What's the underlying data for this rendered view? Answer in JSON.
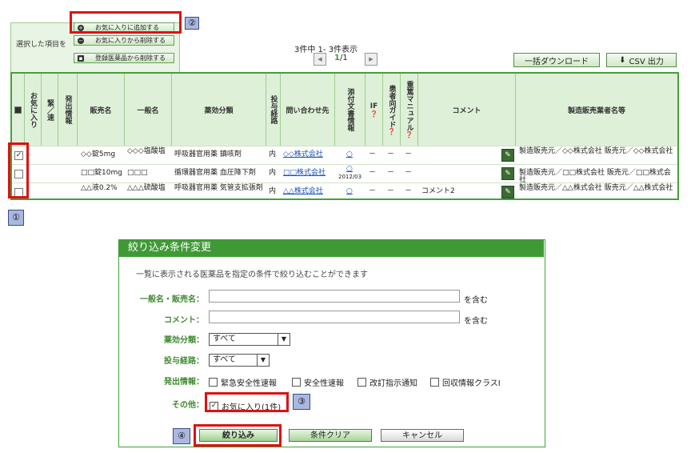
{
  "popup": {
    "label": "選択した項目を",
    "add_fav": "お気に入りに追加する",
    "remove_fav": "お気に入りから削除する",
    "remove_registered": "登録医薬品から削除する"
  },
  "annotations": {
    "n1": "①",
    "n2": "②",
    "n3": "③",
    "n4": "④"
  },
  "pagination": {
    "count": "3件中 1- 3件表示",
    "page": "1",
    "total": "/1"
  },
  "toolbar": {
    "bulk_download": "一括ダウンロード",
    "csv": "CSV 出力"
  },
  "table": {
    "headers": {
      "fav": "お気に入り",
      "urgent": "緊／速",
      "issue": "発出情報",
      "brand": "販売名",
      "generic": "一般名",
      "category": "薬効分類",
      "route": "投与経路",
      "contact": "問い合わせ先",
      "attach": "添付文書情報",
      "if": "IF",
      "patient": "患者向ガイド",
      "manual": "重篤マニュアル",
      "comment": "コメント",
      "maker": "製造販売業者名等"
    },
    "rows": [
      {
        "checked": "✓",
        "brand": "◇◇錠5mg",
        "generic": "◇◇◇塩酸塩",
        "category": "呼吸器官用薬 鎮咳剤",
        "route": "内",
        "contact": "◇◇株式会社",
        "attach": "○",
        "attach_date": "",
        "if": "－",
        "patient": "－",
        "manual": "－",
        "comment": "",
        "maker": "製造販売元／◇◇株式会社 販売元／◇◇株式会社"
      },
      {
        "checked": "",
        "brand": "□□錠10mg",
        "generic": "□□□",
        "category": "循環器官用薬 血圧降下剤",
        "route": "内",
        "contact": "□□株式会社",
        "attach": "○",
        "attach_date": "2012/03",
        "if": "－",
        "patient": "－",
        "manual": "－",
        "comment": "",
        "maker": "製造販売元／□□株式会社 販売元／□□株式会社"
      },
      {
        "checked": "",
        "brand": "△△液0.2%",
        "generic": "△△△硫酸塩",
        "category": "呼吸器官用薬 気管支拡張剤",
        "route": "内",
        "contact": "△△株式会社",
        "attach": "○",
        "attach_date": "",
        "if": "－",
        "patient": "－",
        "manual": "－",
        "comment": "コメント2",
        "maker": "製造販売元／△△株式会社 販売元／△△株式会社"
      }
    ]
  },
  "filter": {
    "title": "絞り込み条件変更",
    "desc": "一覧に表示される医薬品を指定の条件で絞り込むことができます",
    "name_label": "一般名・販売名：",
    "name_value": "",
    "name_suffix": "を含む",
    "comment_label": "コメント：",
    "comment_value": "",
    "comment_suffix": "を含む",
    "category_label": "薬効分類：",
    "category_value": "すべて",
    "route_label": "投与経路：",
    "route_value": "すべて",
    "issue_label": "発出情報：",
    "issue_options": [
      "緊急安全性速報",
      "安全性速報",
      "改訂指示通知",
      "回収情報クラスⅠ"
    ],
    "other_label": "その他：",
    "other_option": "お気に入り(1件)",
    "submit": "絞り込み",
    "clear": "条件クリア",
    "cancel": "キャンセル"
  },
  "colors": {
    "accent": "#3f9a35",
    "header_bg": "#dff0d8",
    "highlight": "#e01010",
    "badge": "#aab8e0"
  }
}
